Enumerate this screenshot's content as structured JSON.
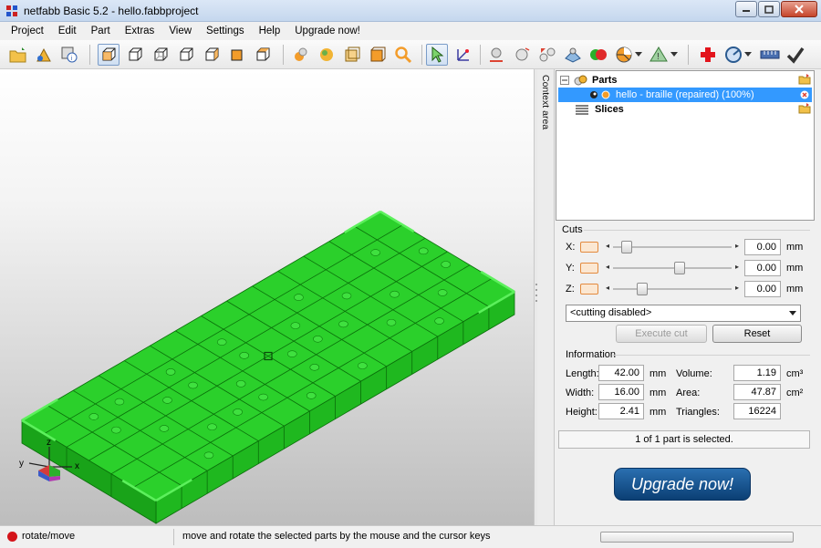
{
  "window": {
    "title": "netfabb Basic 5.2 - hello.fabbproject"
  },
  "menu": [
    "Project",
    "Edit",
    "Part",
    "Extras",
    "View",
    "Settings",
    "Help",
    "Upgrade now!"
  ],
  "context_tab": "Context area",
  "tree": {
    "parts_label": "Parts",
    "part_name": "hello - braille (repaired) (100%)",
    "slices_label": "Slices"
  },
  "cuts": {
    "title": "Cuts",
    "axes": [
      {
        "label": "X:",
        "value": "0.00",
        "unit": "mm",
        "slider_position": 0.06
      },
      {
        "label": "Y:",
        "value": "0.00",
        "unit": "mm",
        "slider_position": 0.55
      },
      {
        "label": "Z:",
        "value": "0.00",
        "unit": "mm",
        "slider_position": 0.2
      }
    ],
    "mode": "<cutting disabled>",
    "execute_label": "Execute cut",
    "reset_label": "Reset"
  },
  "information": {
    "title": "Information",
    "length_label": "Length:",
    "length_value": "42.00",
    "length_unit": "mm",
    "width_label": "Width:",
    "width_value": "16.00",
    "width_unit": "mm",
    "height_label": "Height:",
    "height_value": "2.41",
    "height_unit": "mm",
    "volume_label": "Volume:",
    "volume_value": "1.19",
    "volume_unit": "cm³",
    "area_label": "Area:",
    "area_value": "47.87",
    "area_unit": "cm²",
    "triangles_label": "Triangles:",
    "triangles_value": "16224"
  },
  "selection_status": "1 of 1 part is selected.",
  "upgrade_label": "Upgrade now!",
  "status": {
    "mode": "rotate/move",
    "hint": "move and rotate the selected parts by the mouse and the cursor keys"
  },
  "axes_gizmo": {
    "x": "x",
    "y": "y",
    "z": "z"
  },
  "colors": {
    "part_green": "#2bd02b",
    "grid_dark": "#0a6e0a",
    "selection_blue": "#3399ff",
    "accent_orange": "#e38a3e",
    "upgrade_blue": "#0b3f74"
  }
}
